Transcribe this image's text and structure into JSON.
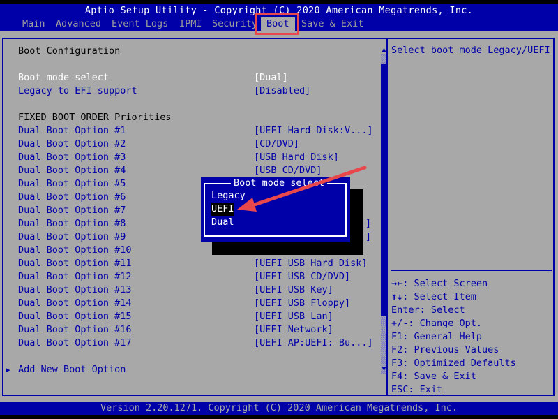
{
  "header": {
    "title": "Aptio Setup Utility - Copyright (C) 2020 American Megatrends, Inc.",
    "tabs": [
      {
        "label": "Main"
      },
      {
        "label": "Advanced"
      },
      {
        "label": "Event Logs"
      },
      {
        "label": "IPMI"
      },
      {
        "label": "Security"
      },
      {
        "label": "Boot",
        "active": true
      },
      {
        "label": "Save & Exit"
      }
    ]
  },
  "boot": {
    "section_title": "Boot Configuration",
    "boot_mode": {
      "label": "Boot mode select",
      "value": "[Dual]"
    },
    "legacy_efi": {
      "label": "Legacy to EFI support",
      "value": "[Disabled]"
    },
    "fixed_order_title": "FIXED BOOT ORDER Priorities",
    "options": [
      {
        "label": "Dual Boot Option #1",
        "value": "[UEFI Hard Disk:V...]"
      },
      {
        "label": "Dual Boot Option #2",
        "value": "[CD/DVD]"
      },
      {
        "label": "Dual Boot Option #3",
        "value": "[USB Hard Disk]"
      },
      {
        "label": "Dual Boot Option #4",
        "value": "[USB CD/DVD]"
      },
      {
        "label": "Dual Boot Option #5",
        "value": ""
      },
      {
        "label": "Dual Boot Option #6",
        "value": ""
      },
      {
        "label": "Dual Boot Option #7",
        "value": ""
      },
      {
        "label": "Dual Boot Option #8",
        "value": "]"
      },
      {
        "label": "Dual Boot Option #9",
        "value": "]"
      },
      {
        "label": "Dual Boot Option #10",
        "value": ""
      },
      {
        "label": "Dual Boot Option #11",
        "value": "[UEFI USB Hard Disk]"
      },
      {
        "label": "Dual Boot Option #12",
        "value": "[UEFI USB CD/DVD]"
      },
      {
        "label": "Dual Boot Option #13",
        "value": "[UEFI USB Key]"
      },
      {
        "label": "Dual Boot Option #14",
        "value": "[UEFI USB Floppy]"
      },
      {
        "label": "Dual Boot Option #15",
        "value": "[UEFI USB Lan]"
      },
      {
        "label": "Dual Boot Option #16",
        "value": "[UEFI Network]"
      },
      {
        "label": "Dual Boot Option #17",
        "value": "[UEFI AP:UEFI: Bu...]"
      }
    ],
    "add_new": {
      "marker": "▶",
      "label": "Add New Boot Option"
    }
  },
  "scrollbar": {
    "up": "▲",
    "down": "▼"
  },
  "help": {
    "description": "Select boot mode Legacy/UEFI",
    "keys": [
      {
        "key": "→←",
        "text": ": Select Screen"
      },
      {
        "key": "↑↓",
        "text": ": Select Item"
      },
      {
        "key": "",
        "text": "Enter: Select"
      },
      {
        "key": "",
        "text": "+/-: Change Opt."
      },
      {
        "key": "",
        "text": "F1: General Help"
      },
      {
        "key": "",
        "text": "F2: Previous Values"
      },
      {
        "key": "",
        "text": "F3: Optimized Defaults"
      },
      {
        "key": "",
        "text": "F4: Save & Exit"
      },
      {
        "key": "",
        "text": "ESC: Exit"
      }
    ]
  },
  "popup": {
    "title": "Boot mode select",
    "items": [
      {
        "label": "Legacy"
      },
      {
        "label": "UEFI",
        "selected": true
      },
      {
        "label": "Dual"
      }
    ]
  },
  "annotation": {
    "color": "#e8474c"
  },
  "footer": "Version 2.20.1271. Copyright (C) 2020 American Megatrends, Inc."
}
